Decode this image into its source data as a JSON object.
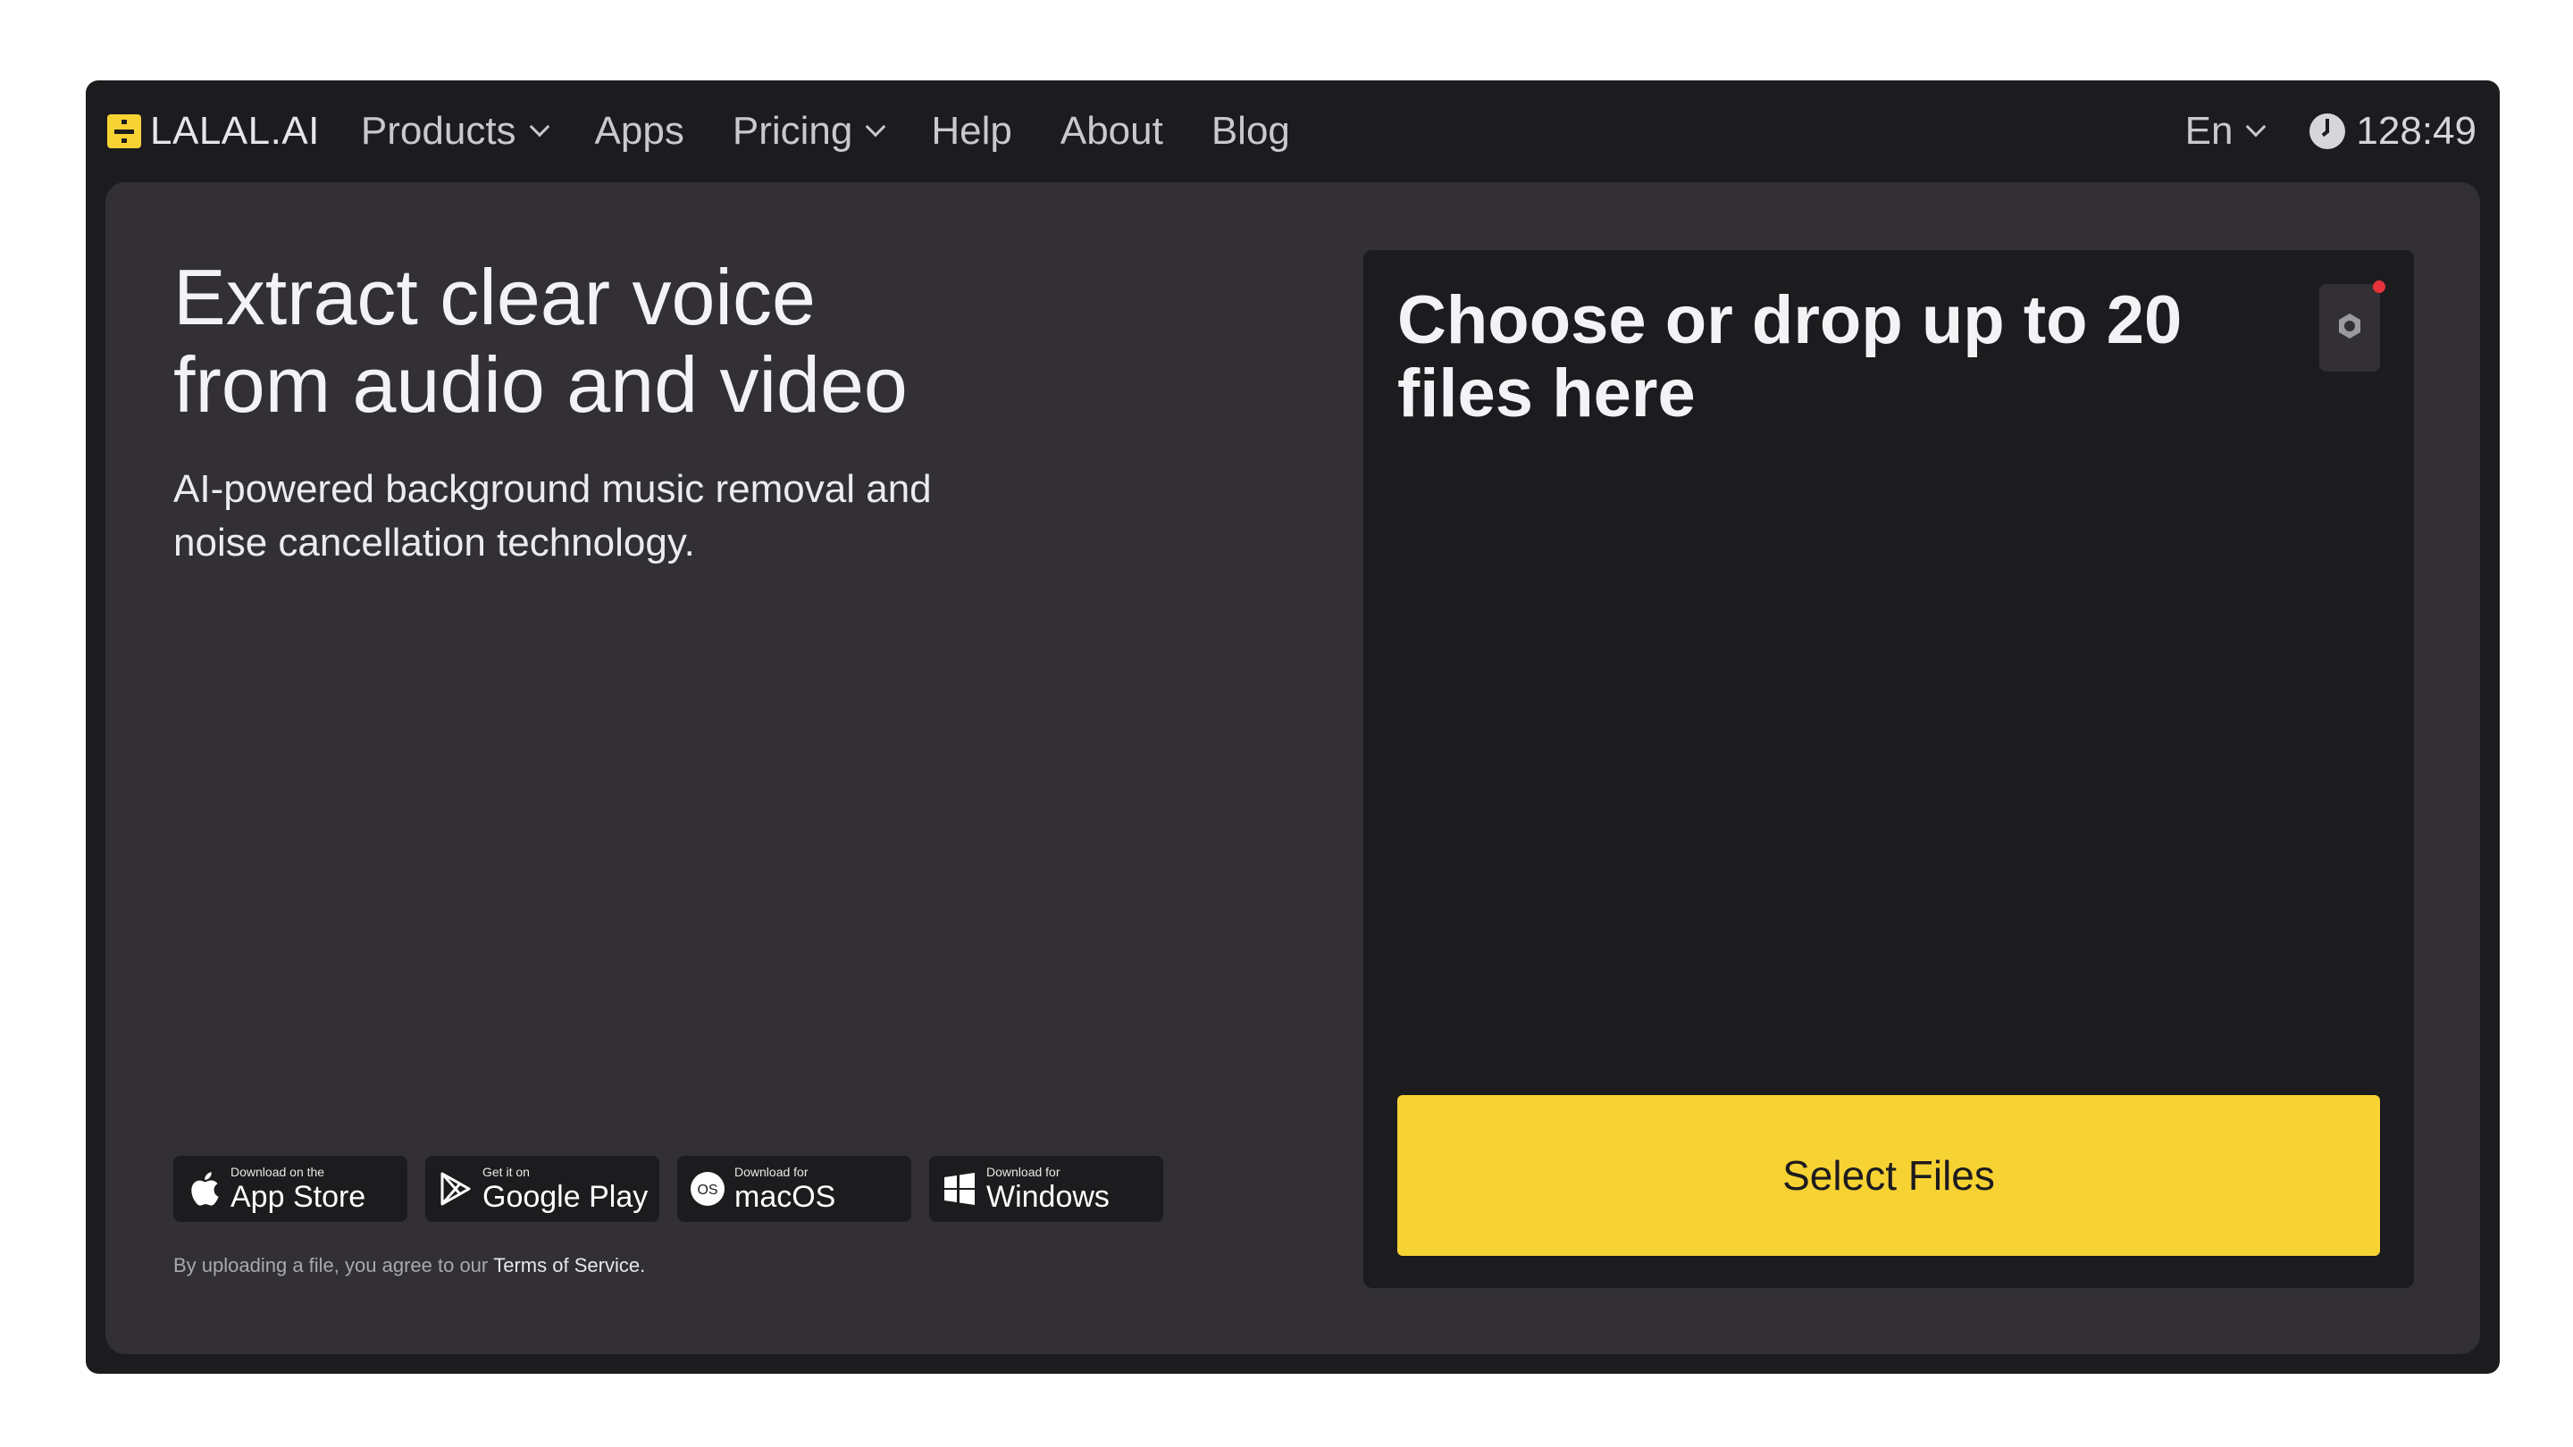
{
  "brand": {
    "name": "LALAL.AI",
    "accent_color": "#f7d233"
  },
  "nav": {
    "items": [
      {
        "label": "Products",
        "has_dropdown": true
      },
      {
        "label": "Apps",
        "has_dropdown": false
      },
      {
        "label": "Pricing",
        "has_dropdown": true
      },
      {
        "label": "Help",
        "has_dropdown": false
      },
      {
        "label": "About",
        "has_dropdown": false
      },
      {
        "label": "Blog",
        "has_dropdown": false
      }
    ],
    "language": "En",
    "timer": "128:49"
  },
  "hero": {
    "title_line1": "Extract clear voice",
    "title_line2": "from audio and video",
    "subtitle_line1": "AI-powered background music removal and",
    "subtitle_line2": "noise cancellation technology."
  },
  "stores": [
    {
      "small": "Download on the",
      "big": "App Store",
      "icon": "apple-icon"
    },
    {
      "small": "Get it on",
      "big": "Google Play",
      "icon": "google-play-icon"
    },
    {
      "small": "Download for",
      "big": "macOS",
      "icon": "macos-icon",
      "badge": "OS"
    },
    {
      "small": "Download for",
      "big": "Windows",
      "icon": "windows-icon"
    }
  ],
  "terms": {
    "text": "By uploading a file, you agree to our",
    "link": "Terms of Service."
  },
  "dropzone": {
    "title_line1": "Choose or drop up to 20",
    "title_line2": "files here",
    "select_label": "Select Files",
    "settings_icon": "gear-icon",
    "notification_color": "#e5323b"
  }
}
